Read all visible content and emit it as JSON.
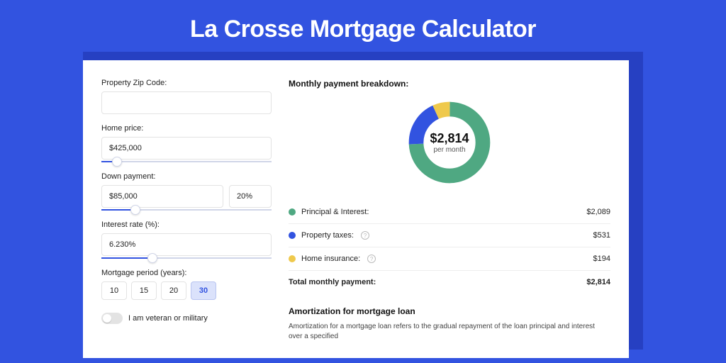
{
  "title": "La Crosse Mortgage Calculator",
  "form": {
    "zip_label": "Property Zip Code:",
    "zip_value": "",
    "home_price_label": "Home price:",
    "home_price_value": "$425,000",
    "home_price_slider_pct": 9,
    "down_label": "Down payment:",
    "down_value": "$85,000",
    "down_pct": "20%",
    "down_slider_pct": 20,
    "rate_label": "Interest rate (%):",
    "rate_value": "6.230%",
    "rate_slider_pct": 30,
    "period_label": "Mortgage period (years):",
    "periods": [
      "10",
      "15",
      "20",
      "30"
    ],
    "period_active": "30",
    "veteran_label": "I am veteran or military"
  },
  "breakdown": {
    "title": "Monthly payment breakdown:",
    "center_amount": "$2,814",
    "center_sub": "per month",
    "rows": [
      {
        "label": "Principal & Interest:",
        "value": "$2,089",
        "color": "#4fa882",
        "info": false
      },
      {
        "label": "Property taxes:",
        "value": "$531",
        "color": "#3253e0",
        "info": true
      },
      {
        "label": "Home insurance:",
        "value": "$194",
        "color": "#efc94c",
        "info": true
      }
    ],
    "total_label": "Total monthly payment:",
    "total_value": "$2,814"
  },
  "amort": {
    "title": "Amortization for mortgage loan",
    "text": "Amortization for a mortgage loan refers to the gradual repayment of the loan principal and interest over a specified"
  },
  "chart_data": {
    "type": "pie",
    "title": "Monthly payment breakdown",
    "series": [
      {
        "name": "Principal & Interest",
        "value": 2089,
        "color": "#4fa882"
      },
      {
        "name": "Property taxes",
        "value": 531,
        "color": "#3253e0"
      },
      {
        "name": "Home insurance",
        "value": 194,
        "color": "#efc94c"
      }
    ],
    "total": 2814
  }
}
